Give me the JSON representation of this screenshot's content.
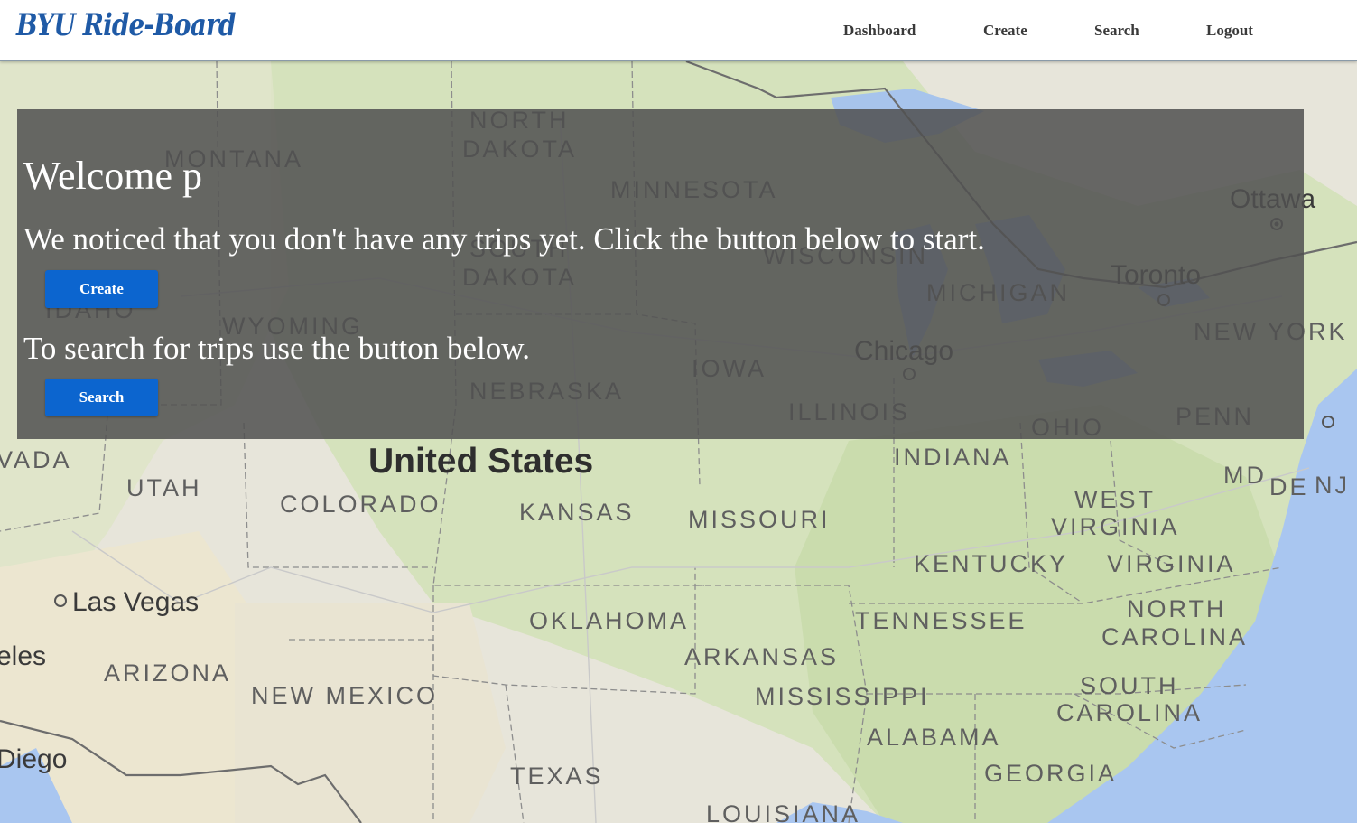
{
  "header": {
    "brand": "BYU Ride-Board",
    "nav": [
      "Dashboard",
      "Create",
      "Search",
      "Logout"
    ]
  },
  "panel": {
    "welcome": "Welcome p",
    "no_trips_message": "We noticed that you don't have any trips yet. Click the button below to start.",
    "create_button": "Create",
    "search_message": "To search for trips use the button below.",
    "search_button": "Search"
  },
  "map": {
    "country_label": "United States",
    "state_labels": [
      "MONTANA",
      "NORTH",
      "DAKOTA",
      "MINNESOTA",
      "SOUTH",
      "DAKOTA",
      "WISCONSIN",
      "MICHIGAN",
      "IDAHO",
      "WYOMING",
      "IOWA",
      "NEBRASKA",
      "ILLINOIS",
      "OHIO",
      "PENN",
      "NEW YORK",
      "VADA",
      "UTAH",
      "COLORADO",
      "KANSAS",
      "MISSOURI",
      "INDIANA",
      "WEST",
      "VIRGINIA",
      "MD",
      "DE",
      "NJ",
      "KENTUCKY",
      "VIRGINIA",
      "NORTH",
      "CAROLINA",
      "TENNESSEE",
      "OKLAHOMA",
      "ARKANSAS",
      "ARIZONA",
      "NEW MEXICO",
      "MISSISSIPPI",
      "SOUTH",
      "CAROLINA",
      "ALABAMA",
      "GEORGIA",
      "TEXAS",
      "LOUISIANA"
    ],
    "city_labels": [
      "Ottawa",
      "Toronto",
      "Chicago",
      "Las Vegas",
      "eles",
      "Diego"
    ],
    "colors": {
      "land": "#e6e5dc",
      "green": "#cfdfb4",
      "water": "#a9c6f0",
      "border": "#7c7c7c"
    }
  }
}
